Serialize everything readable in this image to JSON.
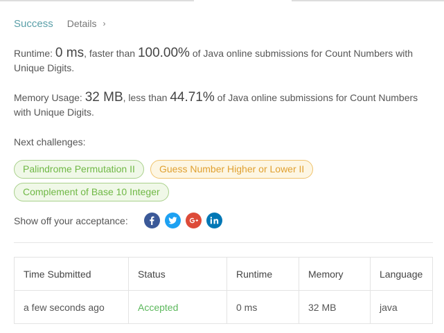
{
  "status": {
    "result": "Success",
    "details_label": "Details",
    "details_chevron": "›"
  },
  "runtime": {
    "label": "Runtime: ",
    "value": "0 ms",
    "faster_than_label": ", faster than ",
    "percent": "100.00%",
    "suffix": " of Java online submissions for Count Numbers with Unique Digits."
  },
  "memory": {
    "label": "Memory Usage: ",
    "value": "32 MB",
    "less_than_label": ", less than ",
    "percent": "44.71%",
    "suffix": " of Java online submissions for Count Numbers with Unique Digits."
  },
  "next_challenges": {
    "label": "Next challenges:",
    "items": [
      {
        "title": "Palindrome Permutation II",
        "difficulty": "easy"
      },
      {
        "title": "Guess Number Higher or Lower II",
        "difficulty": "medium"
      },
      {
        "title": "Complement of Base 10 Integer",
        "difficulty": "easy"
      }
    ]
  },
  "share": {
    "label": "Show off your acceptance:",
    "icons": [
      {
        "name": "facebook-icon",
        "color": "#3b5998"
      },
      {
        "name": "twitter-icon",
        "color": "#1da1f2"
      },
      {
        "name": "google-plus-icon",
        "color": "#dd4b39"
      },
      {
        "name": "linkedin-icon",
        "color": "#0077b5"
      }
    ]
  },
  "submissions": {
    "headers": [
      "Time Submitted",
      "Status",
      "Runtime",
      "Memory",
      "Language"
    ],
    "rows": [
      {
        "time": "a few seconds ago",
        "status": "Accepted",
        "runtime": "0 ms",
        "memory": "32 MB",
        "language": "java"
      }
    ]
  },
  "colors": {
    "success": "#5a9fa8",
    "accepted": "#5cb85c",
    "easy": "#6fb845",
    "medium": "#e0a030"
  }
}
